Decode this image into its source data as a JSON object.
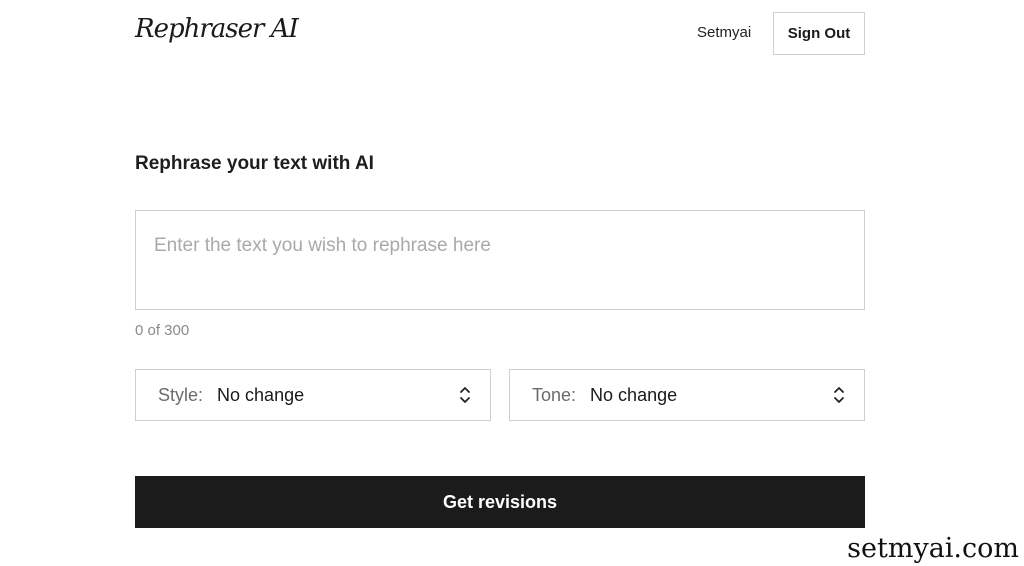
{
  "header": {
    "logo": "Rephraser AI",
    "username": "Setmyai",
    "signout_label": "Sign Out"
  },
  "main": {
    "heading": "Rephrase your text with AI",
    "input": {
      "value": "",
      "placeholder": "Enter the text you wish to rephrase here"
    },
    "counter": "0 of 300",
    "style_select": {
      "label": "Style:",
      "value": "No change"
    },
    "tone_select": {
      "label": "Tone:",
      "value": "No change"
    },
    "submit_label": "Get revisions"
  },
  "watermark": "setmyai.com",
  "icons": {
    "select_chevron": "chevron-up-down-icon"
  }
}
